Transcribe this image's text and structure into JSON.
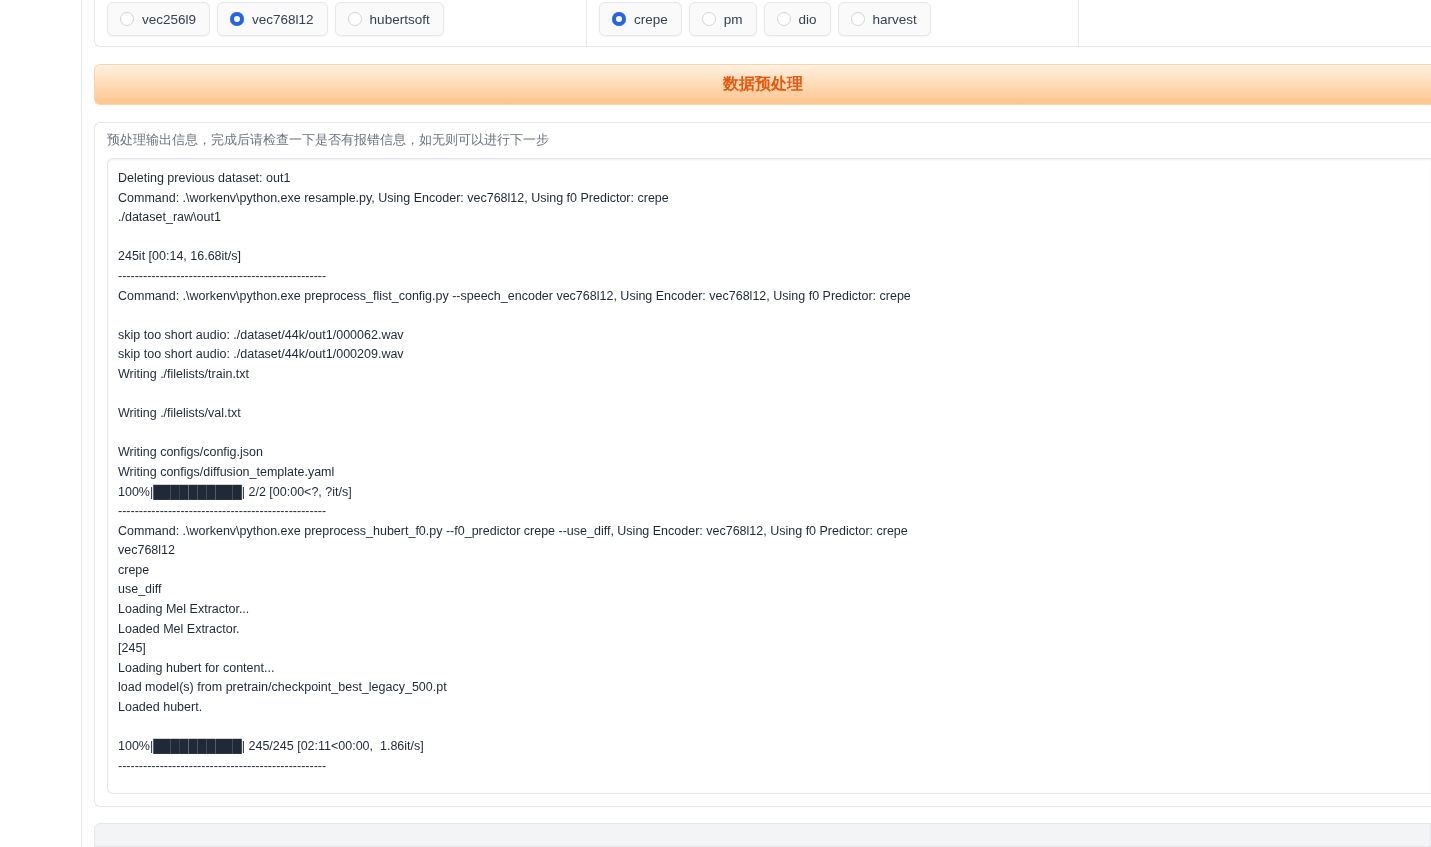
{
  "radio_groups": [
    {
      "options": [
        {
          "label": "vec256l9",
          "selected": false
        },
        {
          "label": "vec768l12",
          "selected": true
        },
        {
          "label": "hubertsoft",
          "selected": false
        }
      ]
    },
    {
      "options": [
        {
          "label": "crepe",
          "selected": true
        },
        {
          "label": "pm",
          "selected": false
        },
        {
          "label": "dio",
          "selected": false
        },
        {
          "label": "harvest",
          "selected": false
        }
      ]
    }
  ],
  "preprocess_button": {
    "label": "数据预处理"
  },
  "output": {
    "label": "预处理输出信息，完成后请检查一下是否有报错信息，如无则可以进行下一步",
    "value": "Deleting previous dataset: out1\nCommand: .\\workenv\\python.exe resample.py, Using Encoder: vec768l12, Using f0 Predictor: crepe\n./dataset_raw\\out1\n\n245it [00:14, 16.68it/s]\n--------------------------------------------------\nCommand: .\\workenv\\python.exe preprocess_flist_config.py --speech_encoder vec768l12, Using Encoder: vec768l12, Using f0 Predictor: crepe\n\nskip too short audio: ./dataset/44k/out1/000062.wav\nskip too short audio: ./dataset/44k/out1/000209.wav\nWriting ./filelists/train.txt\n\nWriting ./filelists/val.txt\n\nWriting configs/config.json\nWriting configs/diffusion_template.yaml\n100%|██████████| 2/2 [00:00<?, ?it/s]\n--------------------------------------------------\nCommand: .\\workenv\\python.exe preprocess_hubert_f0.py --f0_predictor crepe --use_diff, Using Encoder: vec768l12, Using f0 Predictor: crepe\nvec768l12\ncrepe\nuse_diff\nLoading Mel Extractor...\nLoaded Mel Extractor.\n[245]\nLoading hubert for content...\nload model(s) from pretrain/checkpoint_best_legacy_500.pt\nLoaded hubert.\n\n100%|██████████| 245/245 [02:11<00:00,  1.86it/s]\n--------------------------------------------------"
  }
}
